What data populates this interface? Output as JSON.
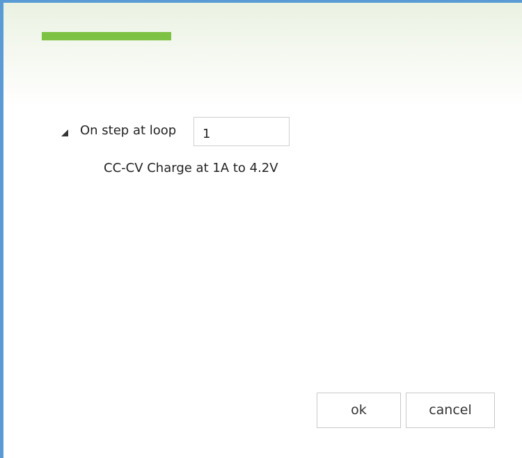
{
  "accent_color": "#7dc242",
  "border_color": "#5b9bd5",
  "tree": {
    "node": {
      "label": "On step at loop",
      "expanded": true,
      "expander_icon": "triangle-expanded-icon",
      "loop_value": "1",
      "child_text": "CC-CV Charge at 1A to 4.2V"
    }
  },
  "buttons": {
    "ok_label": "ok",
    "cancel_label": "cancel"
  }
}
